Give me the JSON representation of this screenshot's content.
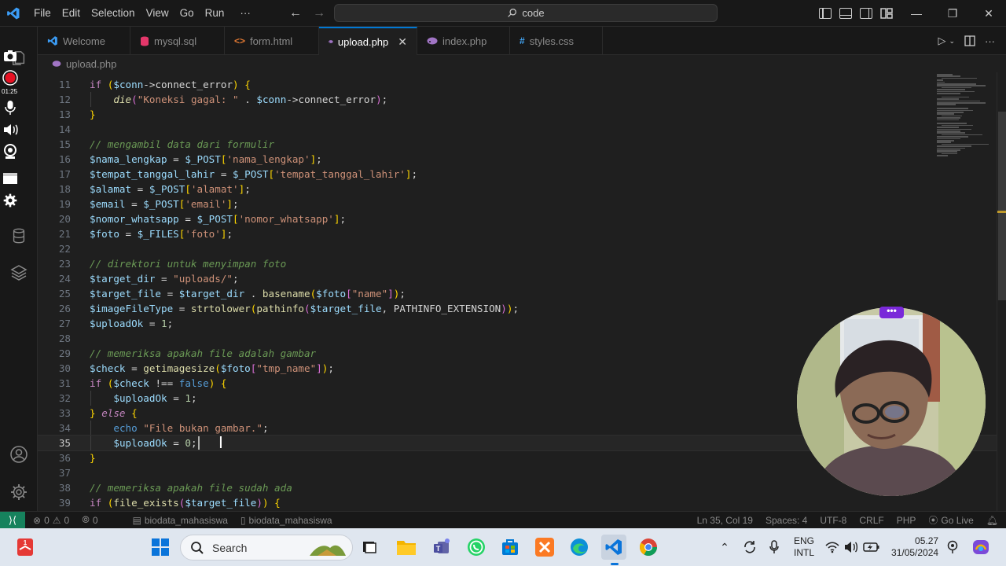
{
  "titlebar": {
    "menu": [
      "File",
      "Edit",
      "Selection",
      "View",
      "Go",
      "Run",
      "···"
    ],
    "command_center": "code",
    "controls": {
      "minimize": "—",
      "restore": "❐",
      "close": "✕"
    }
  },
  "tabs": [
    {
      "label": "Welcome",
      "icon": "vscode-icon",
      "color": "#3b9cf5",
      "active": false
    },
    {
      "label": "mysql.sql",
      "icon": "database-icon",
      "color": "#e4376a",
      "active": false
    },
    {
      "label": "form.html",
      "icon": "html-icon",
      "color": "#e37933",
      "active": false
    },
    {
      "label": "upload.php",
      "icon": "php-icon",
      "color": "#a074c4",
      "active": true
    },
    {
      "label": "index.php",
      "icon": "php-icon",
      "color": "#a074c4",
      "active": false
    },
    {
      "label": "styles.css",
      "icon": "css-icon",
      "color": "#42a5f5",
      "active": false
    }
  ],
  "breadcrumb": {
    "file": "upload.php"
  },
  "recorder": {
    "time": "01:25"
  },
  "editor": {
    "current_line": 35,
    "lines": [
      {
        "n": "11",
        "tokens": [
          [
            "kw",
            "if"
          ],
          [
            "p",
            " "
          ],
          [
            "br1",
            "("
          ],
          [
            "var",
            "$conn"
          ],
          [
            "p",
            "->"
          ],
          [
            "p",
            "connect_error"
          ],
          [
            "br1",
            ")"
          ],
          [
            "p",
            " "
          ],
          [
            "br1",
            "{"
          ]
        ]
      },
      {
        "n": "12",
        "indent": 1,
        "tokens": [
          [
            "fnc",
            "die"
          ],
          [
            "br2",
            "("
          ],
          [
            "str",
            "\"Koneksi gagal: \""
          ],
          [
            "p",
            " . "
          ],
          [
            "var",
            "$conn"
          ],
          [
            "p",
            "->"
          ],
          [
            "p",
            "connect_error"
          ],
          [
            "br2",
            ")"
          ],
          [
            "p",
            ";"
          ]
        ]
      },
      {
        "n": "13",
        "tokens": [
          [
            "br1",
            "}"
          ]
        ]
      },
      {
        "n": "14",
        "tokens": []
      },
      {
        "n": "15",
        "tokens": [
          [
            "com",
            "// mengambil data dari formulir"
          ]
        ]
      },
      {
        "n": "16",
        "tokens": [
          [
            "var",
            "$nama_lengkap"
          ],
          [
            "p",
            " = "
          ],
          [
            "var",
            "$_POST"
          ],
          [
            "br1",
            "["
          ],
          [
            "str",
            "'nama_lengkap'"
          ],
          [
            "br1",
            "]"
          ],
          [
            "p",
            ";"
          ]
        ]
      },
      {
        "n": "17",
        "tokens": [
          [
            "var",
            "$tempat_tanggal_lahir"
          ],
          [
            "p",
            " = "
          ],
          [
            "var",
            "$_POST"
          ],
          [
            "br1",
            "["
          ],
          [
            "str",
            "'tempat_tanggal_lahir'"
          ],
          [
            "br1",
            "]"
          ],
          [
            "p",
            ";"
          ]
        ]
      },
      {
        "n": "18",
        "tokens": [
          [
            "var",
            "$alamat"
          ],
          [
            "p",
            " = "
          ],
          [
            "var",
            "$_POST"
          ],
          [
            "br1",
            "["
          ],
          [
            "str",
            "'alamat'"
          ],
          [
            "br1",
            "]"
          ],
          [
            "p",
            ";"
          ]
        ]
      },
      {
        "n": "19",
        "tokens": [
          [
            "var",
            "$email"
          ],
          [
            "p",
            " = "
          ],
          [
            "var",
            "$_POST"
          ],
          [
            "br1",
            "["
          ],
          [
            "str",
            "'email'"
          ],
          [
            "br1",
            "]"
          ],
          [
            "p",
            ";"
          ]
        ]
      },
      {
        "n": "20",
        "tokens": [
          [
            "var",
            "$nomor_whatsapp"
          ],
          [
            "p",
            " = "
          ],
          [
            "var",
            "$_POST"
          ],
          [
            "br1",
            "["
          ],
          [
            "str",
            "'nomor_whatsapp'"
          ],
          [
            "br1",
            "]"
          ],
          [
            "p",
            ";"
          ]
        ]
      },
      {
        "n": "21",
        "tokens": [
          [
            "var",
            "$foto"
          ],
          [
            "p",
            " = "
          ],
          [
            "var",
            "$_FILES"
          ],
          [
            "br1",
            "["
          ],
          [
            "str",
            "'foto'"
          ],
          [
            "br1",
            "]"
          ],
          [
            "p",
            ";"
          ]
        ]
      },
      {
        "n": "22",
        "tokens": []
      },
      {
        "n": "23",
        "tokens": [
          [
            "com",
            "// direktori untuk menyimpan foto"
          ]
        ]
      },
      {
        "n": "24",
        "tokens": [
          [
            "var",
            "$target_dir"
          ],
          [
            "p",
            " = "
          ],
          [
            "str",
            "\"uploads/\""
          ],
          [
            "p",
            ";"
          ]
        ]
      },
      {
        "n": "25",
        "tokens": [
          [
            "var",
            "$target_file"
          ],
          [
            "p",
            " = "
          ],
          [
            "var",
            "$target_dir"
          ],
          [
            "p",
            " . "
          ],
          [
            "fn",
            "basename"
          ],
          [
            "br1",
            "("
          ],
          [
            "var",
            "$foto"
          ],
          [
            "br2",
            "["
          ],
          [
            "str",
            "\"name\""
          ],
          [
            "br2",
            "]"
          ],
          [
            "br1",
            ")"
          ],
          [
            "p",
            ";"
          ]
        ]
      },
      {
        "n": "26",
        "tokens": [
          [
            "var",
            "$imageFileType"
          ],
          [
            "p",
            " = "
          ],
          [
            "fn",
            "strtolower"
          ],
          [
            "br1",
            "("
          ],
          [
            "fn",
            "pathinfo"
          ],
          [
            "br2",
            "("
          ],
          [
            "var",
            "$target_file"
          ],
          [
            "p",
            ", "
          ],
          [
            "p",
            "PATHINFO_EXTENSION"
          ],
          [
            "br2",
            ")"
          ],
          [
            "br1",
            ")"
          ],
          [
            "p",
            ";"
          ]
        ]
      },
      {
        "n": "27",
        "tokens": [
          [
            "var",
            "$uploadOk"
          ],
          [
            "p",
            " = "
          ],
          [
            "num",
            "1"
          ],
          [
            "p",
            ";"
          ]
        ]
      },
      {
        "n": "28",
        "tokens": []
      },
      {
        "n": "29",
        "tokens": [
          [
            "com",
            "// memeriksa apakah file adalah gambar"
          ]
        ]
      },
      {
        "n": "30",
        "tokens": [
          [
            "var",
            "$check"
          ],
          [
            "p",
            " = "
          ],
          [
            "fn",
            "getimagesize"
          ],
          [
            "br1",
            "("
          ],
          [
            "var",
            "$foto"
          ],
          [
            "br2",
            "["
          ],
          [
            "str",
            "\"tmp_name\""
          ],
          [
            "br2",
            "]"
          ],
          [
            "br1",
            ")"
          ],
          [
            "p",
            ";"
          ]
        ]
      },
      {
        "n": "31",
        "tokens": [
          [
            "kw",
            "if"
          ],
          [
            "p",
            " "
          ],
          [
            "br1",
            "("
          ],
          [
            "var",
            "$check"
          ],
          [
            "p",
            " !== "
          ],
          [
            "kw2",
            "false"
          ],
          [
            "br1",
            ")"
          ],
          [
            "p",
            " "
          ],
          [
            "br1",
            "{"
          ]
        ]
      },
      {
        "n": "32",
        "indent": 1,
        "tokens": [
          [
            "var",
            "$uploadOk"
          ],
          [
            "p",
            " = "
          ],
          [
            "num",
            "1"
          ],
          [
            "p",
            ";"
          ]
        ]
      },
      {
        "n": "33",
        "tokens": [
          [
            "br1",
            "}"
          ],
          [
            "p",
            " "
          ],
          [
            "kwi",
            "else"
          ],
          [
            "p",
            " "
          ],
          [
            "br1",
            "{"
          ]
        ]
      },
      {
        "n": "34",
        "indent": 1,
        "tokens": [
          [
            "kw2",
            "echo"
          ],
          [
            "p",
            " "
          ],
          [
            "str",
            "\"File bukan gambar.\""
          ],
          [
            "p",
            ";"
          ]
        ]
      },
      {
        "n": "35",
        "indent": 1,
        "tokens": [
          [
            "var",
            "$uploadOk"
          ],
          [
            "p",
            " = "
          ],
          [
            "num",
            "0"
          ],
          [
            "p",
            ";"
          ]
        ]
      },
      {
        "n": "36",
        "tokens": [
          [
            "br1",
            "}"
          ]
        ]
      },
      {
        "n": "37",
        "tokens": []
      },
      {
        "n": "38",
        "tokens": [
          [
            "com",
            "// memeriksa apakah file sudah ada"
          ]
        ]
      },
      {
        "n": "39",
        "tokens": [
          [
            "kw",
            "if"
          ],
          [
            "p",
            " "
          ],
          [
            "br1",
            "("
          ],
          [
            "fn",
            "file_exists"
          ],
          [
            "br2",
            "("
          ],
          [
            "var",
            "$target_file"
          ],
          [
            "br2",
            ")"
          ],
          [
            "br1",
            ")"
          ],
          [
            "p",
            " "
          ],
          [
            "br1",
            "{"
          ]
        ]
      }
    ]
  },
  "statusbar": {
    "errors": "0",
    "warnings": "0",
    "ports": "0",
    "branch1": "biodata_mahasiswa",
    "branch2": "biodata_mahasiswa",
    "position": "Ln 35, Col 19",
    "spaces": "Spaces: 4",
    "encoding": "UTF-8",
    "eol": "CRLF",
    "language": "PHP",
    "golive": "Go Live"
  },
  "taskbar": {
    "search_placeholder": "Search",
    "lang_line1": "ENG",
    "lang_line2": "INTL",
    "time": "05.27",
    "date": "31/05/2024",
    "notif_badge": "1"
  },
  "colors": {
    "accent": "#0078d4",
    "remote": "#16825d",
    "recorder": "#e81123",
    "webcam_menu": "#7a29d9"
  }
}
